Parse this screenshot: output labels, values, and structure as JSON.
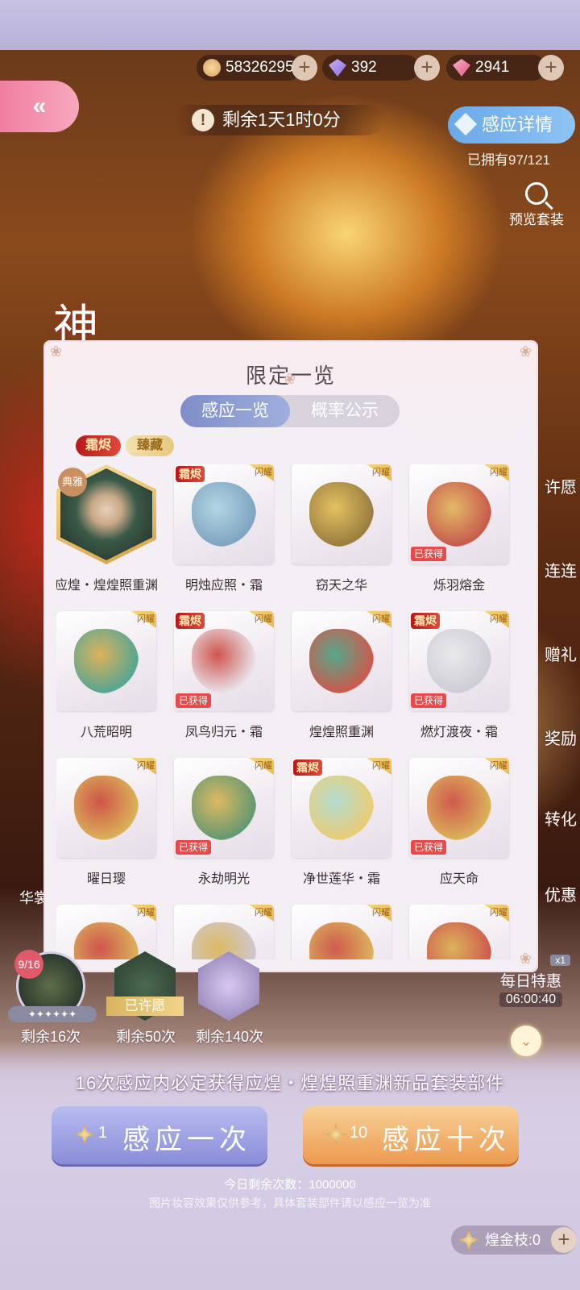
{
  "currencies": [
    {
      "icon": "cat-coin-icon",
      "value": "58326295"
    },
    {
      "icon": "diamond-icon",
      "value": "392"
    },
    {
      "icon": "pink-crystal-icon",
      "value": "2941"
    }
  ],
  "back_label": "«",
  "timer": {
    "icon": "!",
    "text": "剩余1天1时0分"
  },
  "detail_button": "感应详情",
  "owned": "已拥有97/121",
  "preview": "预览套装",
  "side_tabs": [
    "许愿",
    "连连",
    "赠礼",
    "奖励",
    "转化",
    "优惠"
  ],
  "side_left": "华裳",
  "banner_char": "神",
  "modal": {
    "title": "限定一览",
    "tabs": [
      "感应一览",
      "概率公示"
    ],
    "rarity_tags": [
      "霜烬",
      "臻藏"
    ],
    "ribbon": "闪耀",
    "items": [
      {
        "name": "应煌・煌煌照重渊",
        "badge": "典雅",
        "shuang": false,
        "obtained": false,
        "hex": true
      },
      {
        "name": "明烛应照・霜",
        "shuang": true,
        "obtained": false
      },
      {
        "name": "窃天之华",
        "shuang": false,
        "obtained": false
      },
      {
        "name": "烁羽熔金",
        "shuang": false,
        "obtained": true
      },
      {
        "name": "八荒昭明",
        "shuang": false,
        "obtained": false
      },
      {
        "name": "凤鸟归元・霜",
        "shuang": true,
        "obtained": true
      },
      {
        "name": "煌煌照重渊",
        "shuang": false,
        "obtained": false
      },
      {
        "name": "燃灯渡夜・霜",
        "shuang": true,
        "obtained": true
      },
      {
        "name": "曜日璎",
        "shuang": false,
        "obtained": false
      },
      {
        "name": "永劫明光",
        "shuang": false,
        "obtained": true
      },
      {
        "name": "净世莲华・霜",
        "shuang": true,
        "obtained": false
      },
      {
        "name": "应天命",
        "shuang": false,
        "obtained": true
      },
      {
        "name": "",
        "shuang": false,
        "obtained": false
      },
      {
        "name": "",
        "shuang": false,
        "obtained": false
      },
      {
        "name": "",
        "shuang": false,
        "obtained": false
      },
      {
        "name": "",
        "shuang": false,
        "obtained": false
      }
    ],
    "shuang_label": "霜烬",
    "obtained_label": "已获得"
  },
  "pity": [
    {
      "badge": "9/16",
      "label": "剩余16次",
      "stars": "✦✦✦✦✦✦"
    },
    {
      "status": "已许愿",
      "label": "剩余50次"
    },
    {
      "label": "剩余140次"
    }
  ],
  "guarantee": "16次感应内必定获得应煌・煌煌照重渊新品套装部件",
  "pull_one": {
    "count": "1",
    "label": "感应一次"
  },
  "pull_ten": {
    "count": "10",
    "label": "感应十次"
  },
  "daily": {
    "title": "每日特惠",
    "time": "06:00:40",
    "badge": "x1"
  },
  "remaining_today": "今日剩余次数：1000000",
  "notice": "图片妆容效果仅供参考，具体套装部件请以感应一览为准",
  "gold_branch": "煌金枝:0"
}
